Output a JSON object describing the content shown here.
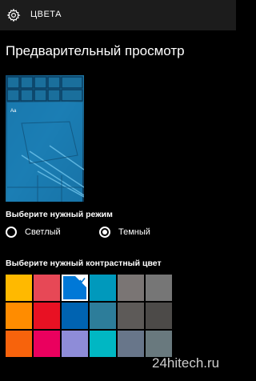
{
  "header": {
    "title": "ЦВЕТА",
    "icon": "gear-icon"
  },
  "page_title": "Предварительный просмотр",
  "preview": {
    "tile_label": "Aa"
  },
  "mode": {
    "label": "Выберите нужный режим",
    "options": [
      {
        "label": "Светлый",
        "selected": false
      },
      {
        "label": "Темный",
        "selected": true
      }
    ]
  },
  "accent": {
    "label": "Выберите нужный контрастный цвет",
    "selected_index": 2,
    "colors": [
      "#ffb900",
      "#e74856",
      "#0078d7",
      "#0099bc",
      "#7a7574",
      "#767676",
      "#ff8c00",
      "#e81123",
      "#0063b1",
      "#2d7d9a",
      "#5d5a58",
      "#4c4a48",
      "#f7630c",
      "#ea005e",
      "#8e8cd8",
      "#00b7c3",
      "#68768a",
      "#69797e"
    ]
  },
  "watermark": "24hitech.ru"
}
